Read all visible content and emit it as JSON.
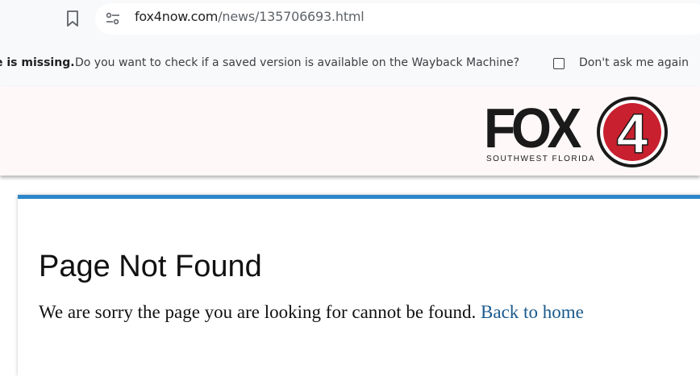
{
  "browser": {
    "url_domain": "fox4now.com",
    "url_path": "/news/135706693.html"
  },
  "infobar": {
    "message_bold": "e is missing.",
    "message": "Do you want to check if a saved version is available on the Wayback Machine?",
    "checkbox_label": "Don't ask me again",
    "checkbox_checked": false
  },
  "header": {
    "logo_text": "FOX",
    "logo_number": "4",
    "logo_subtitle": "SOUTHWEST FLORIDA",
    "colors": {
      "logo_red": "#c8202f",
      "header_bg": "#fff8f8"
    }
  },
  "content": {
    "title": "Page Not Found",
    "message": "We are sorry the page you are looking for cannot be found.",
    "home_link": "Back to home",
    "colors": {
      "accent_border": "#2b87c8",
      "link": "#1b5a8c"
    }
  }
}
